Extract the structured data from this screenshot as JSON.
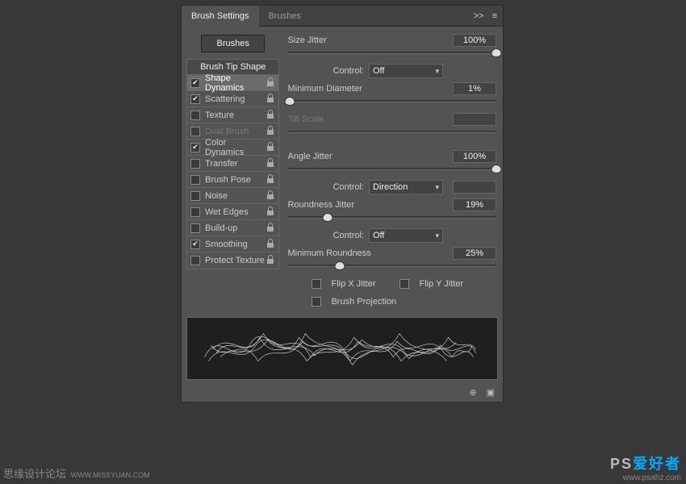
{
  "tabs": {
    "active": "Brush Settings",
    "inactive": "Brushes"
  },
  "brushes_btn": "Brushes",
  "tip_header": "Brush Tip Shape",
  "options": [
    {
      "label": "Shape Dynamics",
      "checked": true,
      "selected": true,
      "lock": true
    },
    {
      "label": "Scattering",
      "checked": true,
      "lock": true
    },
    {
      "label": "Texture",
      "checked": false,
      "lock": true
    },
    {
      "label": "Dual Brush",
      "checked": false,
      "lock": true,
      "disabled": true
    },
    {
      "label": "Color Dynamics",
      "checked": true,
      "lock": true
    },
    {
      "label": "Transfer",
      "checked": false,
      "lock": true
    },
    {
      "label": "Brush Pose",
      "checked": false,
      "lock": true
    },
    {
      "label": "Noise",
      "checked": false,
      "lock": true
    },
    {
      "label": "Wet Edges",
      "checked": false,
      "lock": true
    },
    {
      "label": "Build-up",
      "checked": false,
      "lock": true
    },
    {
      "label": "Smoothing",
      "checked": true,
      "lock": true
    },
    {
      "label": "Protect Texture",
      "checked": false,
      "lock": true
    }
  ],
  "size_jitter": {
    "label": "Size Jitter",
    "value": "100%",
    "pos": 100
  },
  "size_control": {
    "label": "Control:",
    "value": "Off"
  },
  "min_diameter": {
    "label": "Minimum Diameter",
    "value": "1%",
    "pos": 1
  },
  "tilt_scale": {
    "label": "Tilt Scale",
    "value": "",
    "disabled": true
  },
  "angle_jitter": {
    "label": "Angle Jitter",
    "value": "100%",
    "pos": 100
  },
  "angle_control": {
    "label": "Control:",
    "value": "Direction"
  },
  "roundness": {
    "label": "Roundness Jitter",
    "value": "19%",
    "pos": 19
  },
  "round_control": {
    "label": "Control:",
    "value": "Off"
  },
  "min_round": {
    "label": "Minimum Roundness",
    "value": "25%",
    "pos": 25
  },
  "flipx": "Flip X Jitter",
  "flipy": "Flip Y Jitter",
  "proj": "Brush Projection",
  "wm1": {
    "a": "思缘设计论坛",
    "b": "WWW.MISSYUAN.COM"
  },
  "wm2": {
    "a": "PS",
    "b": "爱好者",
    "c": "www.psahz.com"
  }
}
